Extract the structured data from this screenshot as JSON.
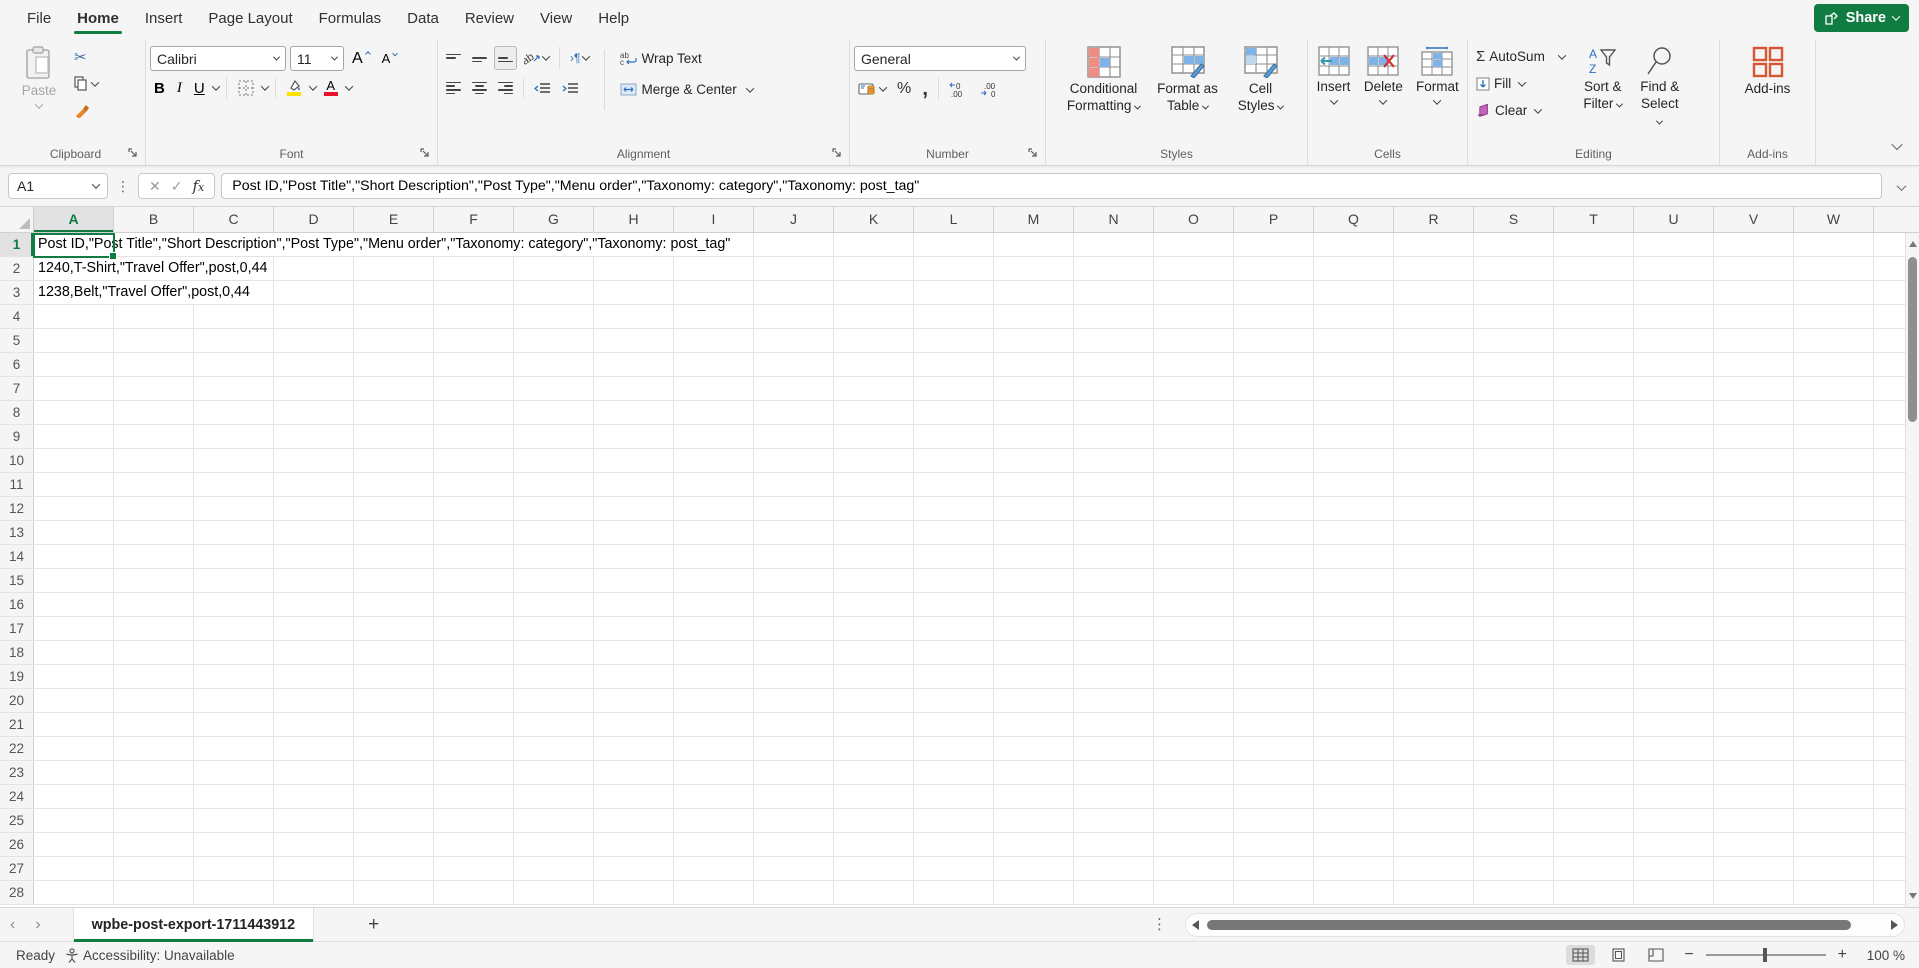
{
  "colors": {
    "accent_green": "#107C41",
    "share_green": "#107C41",
    "addins_orange": "#D65532",
    "highlight_yellow": "#FFE100",
    "font_red": "#E8112D"
  },
  "menu": {
    "tabs": [
      {
        "label": "File"
      },
      {
        "label": "Home"
      },
      {
        "label": "Insert"
      },
      {
        "label": "Page Layout"
      },
      {
        "label": "Formulas"
      },
      {
        "label": "Data"
      },
      {
        "label": "Review"
      },
      {
        "label": "View"
      },
      {
        "label": "Help"
      }
    ],
    "active_tab": "Home"
  },
  "share": {
    "label": "Share"
  },
  "ribbon": {
    "clipboard": {
      "group_label": "Clipboard",
      "paste": "Paste"
    },
    "font": {
      "group_label": "Font",
      "font_name": "Calibri",
      "font_size": "11",
      "bold": "B",
      "italic": "I",
      "underline": "U"
    },
    "alignment": {
      "group_label": "Alignment",
      "wrap_text": "Wrap Text",
      "merge_center": "Merge & Center"
    },
    "number": {
      "group_label": "Number",
      "format": "General",
      "percent": "%",
      "comma": ","
    },
    "styles": {
      "group_label": "Styles",
      "conditional_line1": "Conditional",
      "conditional_line2": "Formatting",
      "format_table_line1": "Format as",
      "format_table_line2": "Table",
      "cell_styles_line1": "Cell",
      "cell_styles_line2": "Styles"
    },
    "cells": {
      "group_label": "Cells",
      "insert": "Insert",
      "delete": "Delete",
      "format": "Format"
    },
    "editing": {
      "group_label": "Editing",
      "autosum": "AutoSum",
      "fill": "Fill",
      "clear": "Clear",
      "sort_line1": "Sort &",
      "sort_line2": "Filter",
      "find_line1": "Find &",
      "find_line2": "Select"
    },
    "addins": {
      "group_label": "Add-ins",
      "button": "Add-ins"
    }
  },
  "formula_bar": {
    "name_box": "A1",
    "formula": "Post ID,\"Post Title\",\"Short Description\",\"Post Type\",\"Menu order\",\"Taxonomy: category\",\"Taxonomy: post_tag\""
  },
  "grid": {
    "columns": [
      "A",
      "B",
      "C",
      "D",
      "E",
      "F",
      "G",
      "H",
      "I",
      "J",
      "K",
      "L",
      "M",
      "N",
      "O",
      "P",
      "Q",
      "R",
      "S",
      "T",
      "U",
      "V",
      "W"
    ],
    "row_count": 28,
    "selected_cell": "A1",
    "selected_col": "A",
    "selected_row": 1,
    "cell_rows": [
      {
        "row": 1,
        "text": "Post ID,\"Post Title\",\"Short Description\",\"Post Type\",\"Menu order\",\"Taxonomy: category\",\"Taxonomy: post_tag\""
      },
      {
        "row": 2,
        "text": "1240,T-Shirt,\"Travel Offer\",post,0,44"
      },
      {
        "row": 3,
        "text": "1238,Belt,\"Travel Offer\",post,0,44"
      }
    ]
  },
  "sheet_tabs": {
    "active": "wpbe-post-export-1711443912",
    "new_tab": "+"
  },
  "status_bar": {
    "ready": "Ready",
    "accessibility": "Accessibility: Unavailable",
    "zoom": "100 %"
  }
}
